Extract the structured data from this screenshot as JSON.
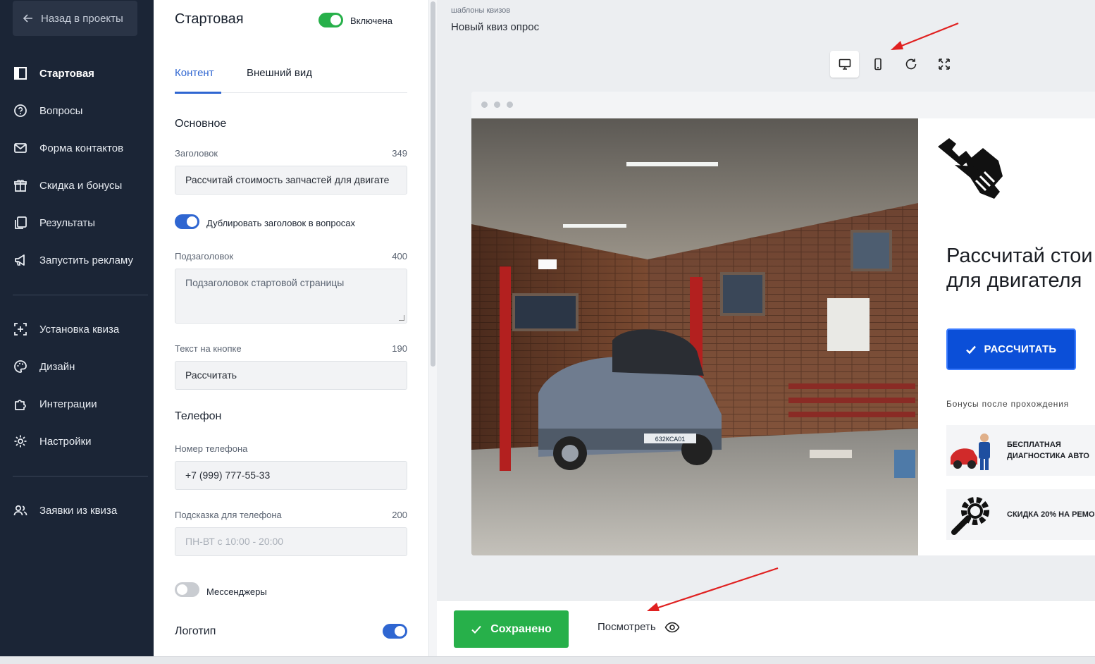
{
  "sidebar": {
    "back_label": "Назад в проекты",
    "items": [
      {
        "label": "Стартовая",
        "icon": "layout-icon",
        "active": true
      },
      {
        "label": "Вопросы",
        "icon": "question-icon"
      },
      {
        "label": "Форма контактов",
        "icon": "mail-icon"
      },
      {
        "label": "Скидка и бонусы",
        "icon": "gift-icon"
      },
      {
        "label": "Результаты",
        "icon": "pages-icon"
      },
      {
        "label": "Запустить рекламу",
        "icon": "megaphone-icon"
      },
      {
        "label": "Установка квиза",
        "icon": "install-icon"
      },
      {
        "label": "Дизайн",
        "icon": "palette-icon"
      },
      {
        "label": "Интеграции",
        "icon": "puzzle-icon"
      },
      {
        "label": "Настройки",
        "icon": "gear-icon"
      },
      {
        "label": "Заявки из квиза",
        "icon": "users-icon"
      }
    ]
  },
  "panel": {
    "title": "Стартовая",
    "enabled_label": "Включена",
    "tabs": [
      "Контент",
      "Внешний вид"
    ],
    "section_main": "Основное",
    "heading_label": "Заголовок",
    "heading_count": "349",
    "heading_value": "Рассчитай стоимость запчастей для двигате",
    "duplicate_label": "Дублировать заголовок в вопросах",
    "subheading_label": "Подзаголовок",
    "subheading_count": "400",
    "subheading_value": "Подзаголовок стартовой страницы",
    "button_text_label": "Текст на кнопке",
    "button_text_count": "190",
    "button_text_value": "Рассчитать",
    "section_phone": "Телефон",
    "phone_label": "Номер телефона",
    "phone_value": "+7 (999) 777-55-33",
    "phone_hint_label": "Подсказка для телефона",
    "phone_hint_count": "200",
    "phone_hint_placeholder": "ПН-ВТ с 10:00 - 20:00",
    "messengers_label": "Мессенджеры",
    "logo_label": "Логотип"
  },
  "preview": {
    "breadcrumb": "шаблоны квизов",
    "quiz_name": "Новый квиз опрос",
    "devices": [
      "desktop-icon",
      "mobile-icon",
      "refresh-icon",
      "fullscreen-icon"
    ],
    "title_line1": "Рассчитай стои",
    "title_line2": "для двигателя",
    "cta_label": "РАССЧИТАТЬ",
    "bonus_heading": "Бонусы после прохождения",
    "bonus_items": [
      {
        "line1": "БЕСПЛАТНАЯ",
        "line2": "ДИАГНОСТИКА АВТО"
      },
      {
        "line1": "СКИДКА 20% НА РЕМО",
        "line2": ""
      }
    ],
    "plate_text": "632КСА01"
  },
  "bottom": {
    "saved_label": "Сохранено",
    "view_label": "Посмотреть"
  },
  "colors": {
    "sidebar_bg": "#1b2536",
    "accent_blue": "#2f66d1",
    "success_green": "#27b04a",
    "cta_blue": "#0b4fd8",
    "arrow_red": "#e02020"
  }
}
